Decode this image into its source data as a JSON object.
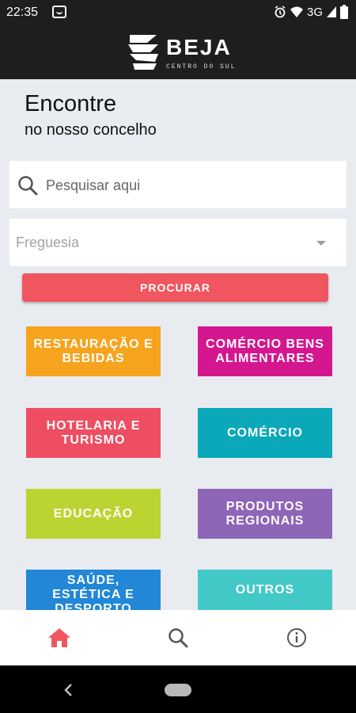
{
  "status_bar": {
    "time": "22:35",
    "network": "3G"
  },
  "app_bar": {
    "logo_title": "BEJA",
    "logo_subtitle": "CENTRO DO SUL"
  },
  "page": {
    "heading": "Encontre",
    "subheading": "no nosso concelho"
  },
  "search": {
    "placeholder": "Pesquisar aqui"
  },
  "freguesia_select": {
    "selected": "Freguesia"
  },
  "procurar_button": {
    "label": "PROCURAR"
  },
  "categories": [
    {
      "label": "RESTAURAÇÃO E BEBIDAS",
      "color": "#f6a31d"
    },
    {
      "label": "COMÉRCIO BENS ALIMENTARES",
      "color": "#d4178f"
    },
    {
      "label": "HOTELARIA E TURISMO",
      "color": "#ed4e62"
    },
    {
      "label": "COMÉRCIO",
      "color": "#0aa8b9"
    },
    {
      "label": "EDUCAÇÃO",
      "color": "#bcd431"
    },
    {
      "label": "PRODUTOS REGIONAIS",
      "color": "#8e66b8"
    },
    {
      "label": "SAÚDE, ESTÉTICA E DESPORTO",
      "color": "#2287d6"
    },
    {
      "label": "OUTROS",
      "color": "#43c8c8"
    }
  ],
  "bottom_nav": [
    {
      "name": "home-icon",
      "active": true,
      "color": "#f0565f"
    },
    {
      "name": "search-icon",
      "active": false,
      "color": "#555555"
    },
    {
      "name": "info-icon",
      "active": false,
      "color": "#555555"
    }
  ]
}
